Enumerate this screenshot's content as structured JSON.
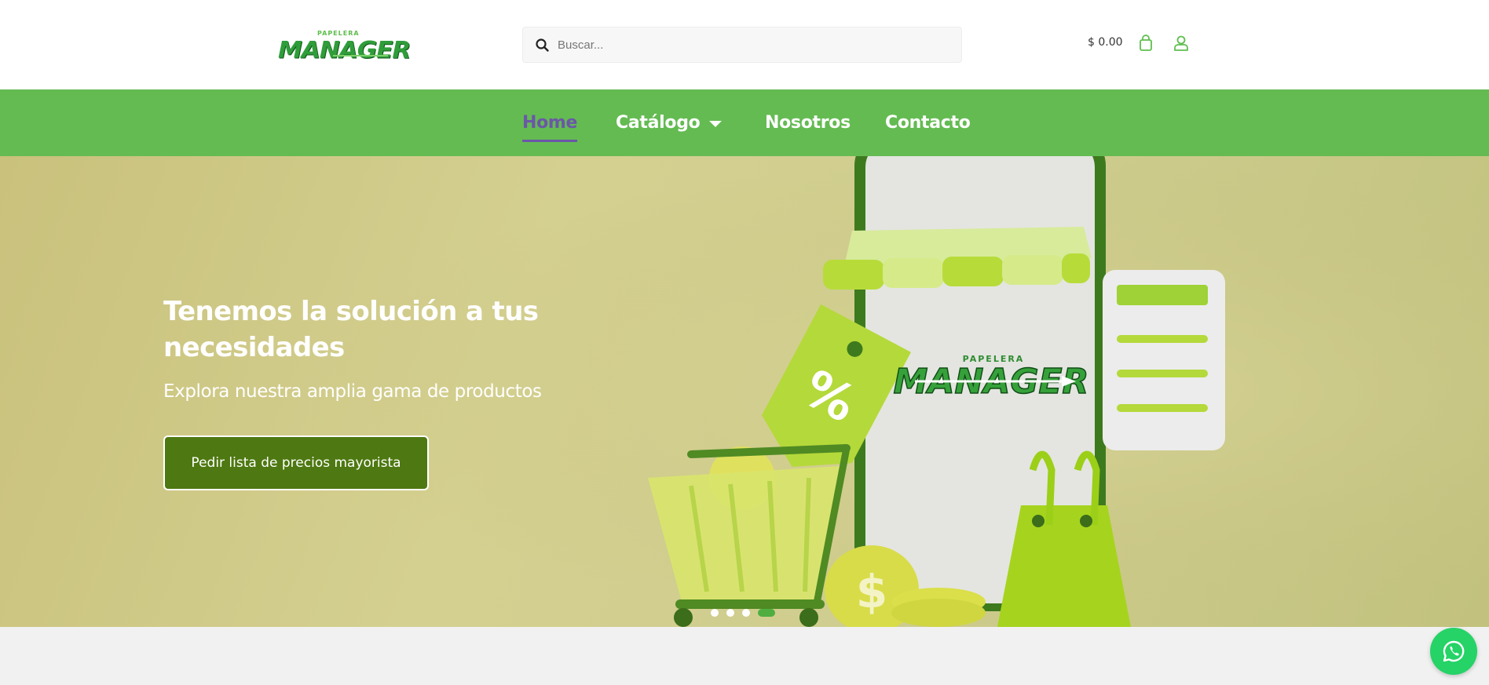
{
  "header": {
    "logo": {
      "top_text": "PAPELERA",
      "main_text": "MANAGER"
    },
    "search": {
      "placeholder": "Buscar..."
    },
    "cart_total": "$ 0.00"
  },
  "nav": {
    "items": [
      {
        "label": "Home",
        "active": true
      },
      {
        "label": "Catálogo",
        "has_dropdown": true
      },
      {
        "label": "Nosotros"
      },
      {
        "label": "Contacto"
      }
    ]
  },
  "hero": {
    "title": "Tenemos la solución a tus necesidades",
    "subtitle": "Explora nuestra amplia gama de productos",
    "button_label": "Pedir lista de precios mayorista",
    "image_logo": {
      "top_text": "PAPELERA",
      "main_text": "MANAGER"
    },
    "slides": 4,
    "active_slide": 4
  },
  "colors": {
    "primary_green": "#64bb52",
    "active_nav": "#6b57a7",
    "button_green": "#4e7811",
    "whatsapp": "#25d366"
  },
  "icons": [
    "search-icon",
    "shopping-bag-icon",
    "user-icon",
    "chevron-down-icon",
    "whatsapp-icon"
  ]
}
